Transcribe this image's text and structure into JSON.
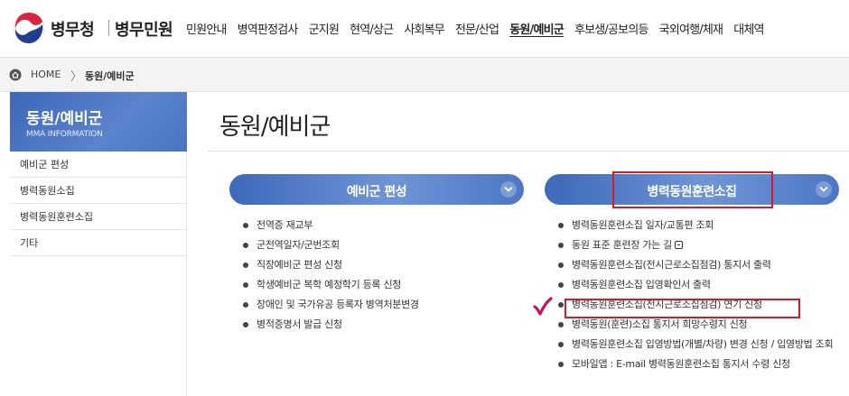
{
  "header": {
    "brand": "병무청",
    "brand_sub": "병무민원",
    "nav": [
      "민원안내",
      "병역판정검사",
      "군지원",
      "현역/상근",
      "사회복무",
      "전문/산업",
      "동원/예비군",
      "후보생/공보의등",
      "국외여행/체재",
      "대체역"
    ],
    "active_nav": "동원/예비군"
  },
  "breadcrumb": {
    "home": "HOME",
    "separator": "〉",
    "current": "동원/예비군"
  },
  "sidebar": {
    "title": "동원/예비군",
    "subtitle": "MMA INFORMATION",
    "items": [
      "예비군 편성",
      "병력동원소집",
      "병력동원훈련소집",
      "기타"
    ]
  },
  "main": {
    "title": "동원/예비군",
    "left_section": {
      "label": "예비군 편성",
      "items": [
        "전역증 재교부",
        "군전역일자/군번조회",
        "직장예비군 편성 신청",
        "학생예비군 복학 예정학기 등록 신청",
        "장애인 및 국가유공 등록자 병역처분변경",
        "병적증명서 발급 신청"
      ]
    },
    "right_section": {
      "label": "병력동원훈련소집",
      "items": [
        "병력동원훈련소집 일자/교통편 조회",
        "동원 표준 훈련장 가는 길",
        "병력동원훈련소집(전시근로소집점검) 통지서 출력",
        "병력동원훈련소집 입영확인서 출력",
        "병력동원훈련소집(전시근로소집점검) 연기 신청",
        "병력동원(훈련)소집 통지서 희망수령지 신청",
        "병력동원훈련소집 입영방법(개별/차량) 변경 신청 / 입영방법 조회",
        "모바일앱 : E-mail 병력동원훈련소집 통지서 수령 신청"
      ]
    }
  },
  "colors": {
    "accent_blue": "#4a74c2",
    "highlight_red": "#d71a28",
    "check_magenta": "#c4125e"
  }
}
